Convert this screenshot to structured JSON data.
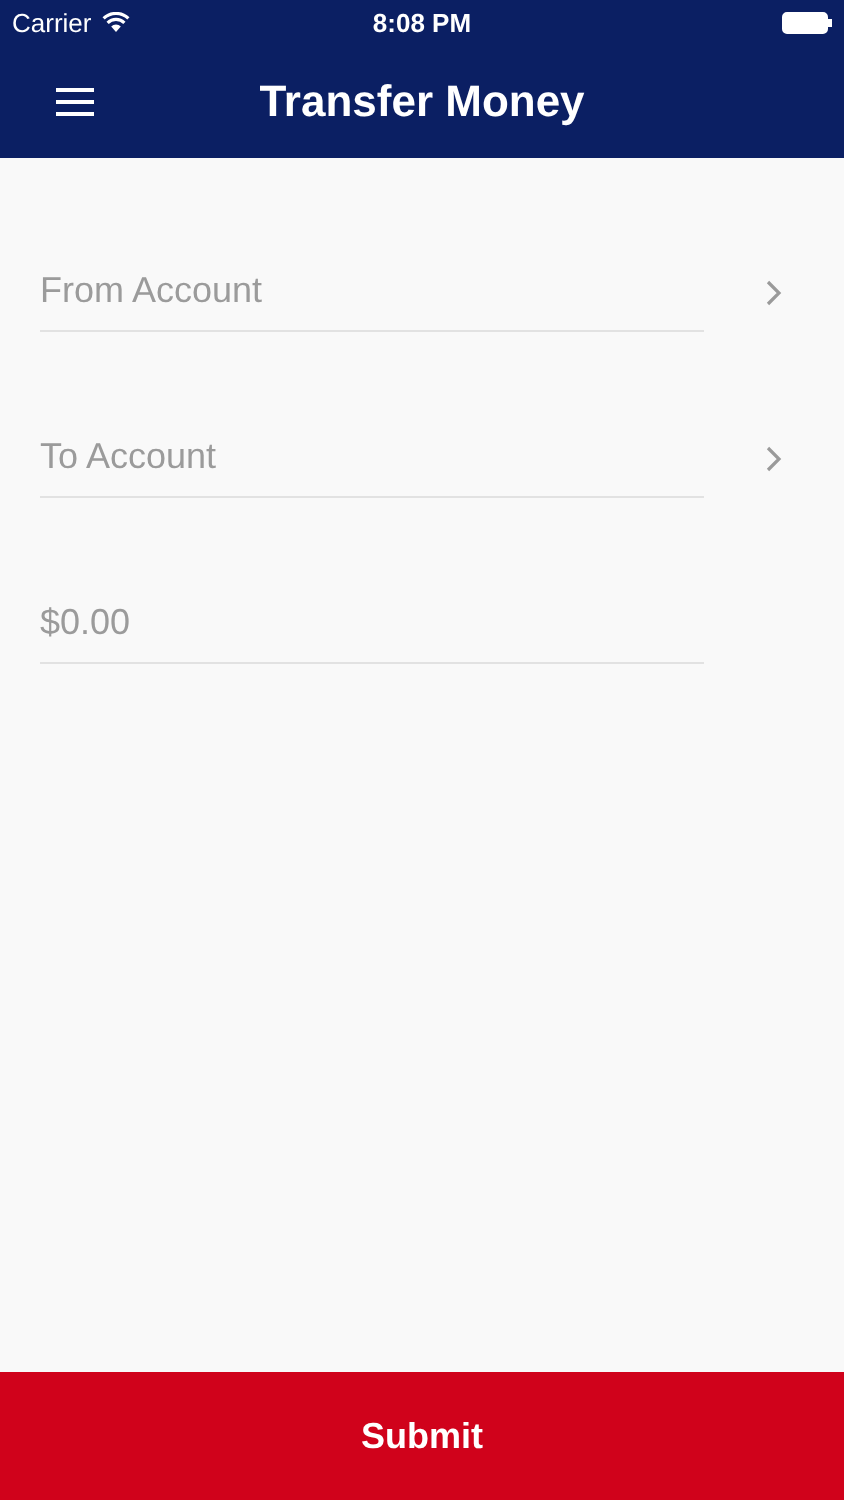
{
  "status_bar": {
    "carrier": "Carrier",
    "time": "8:08 PM"
  },
  "nav_bar": {
    "title": "Transfer Money"
  },
  "fields": [
    {
      "kind": "picker",
      "placeholder": "From Account"
    },
    {
      "kind": "picker",
      "placeholder": "To Account"
    },
    {
      "kind": "amount",
      "placeholder": "$0.00"
    }
  ],
  "submit_button": {
    "label": "Submit"
  }
}
